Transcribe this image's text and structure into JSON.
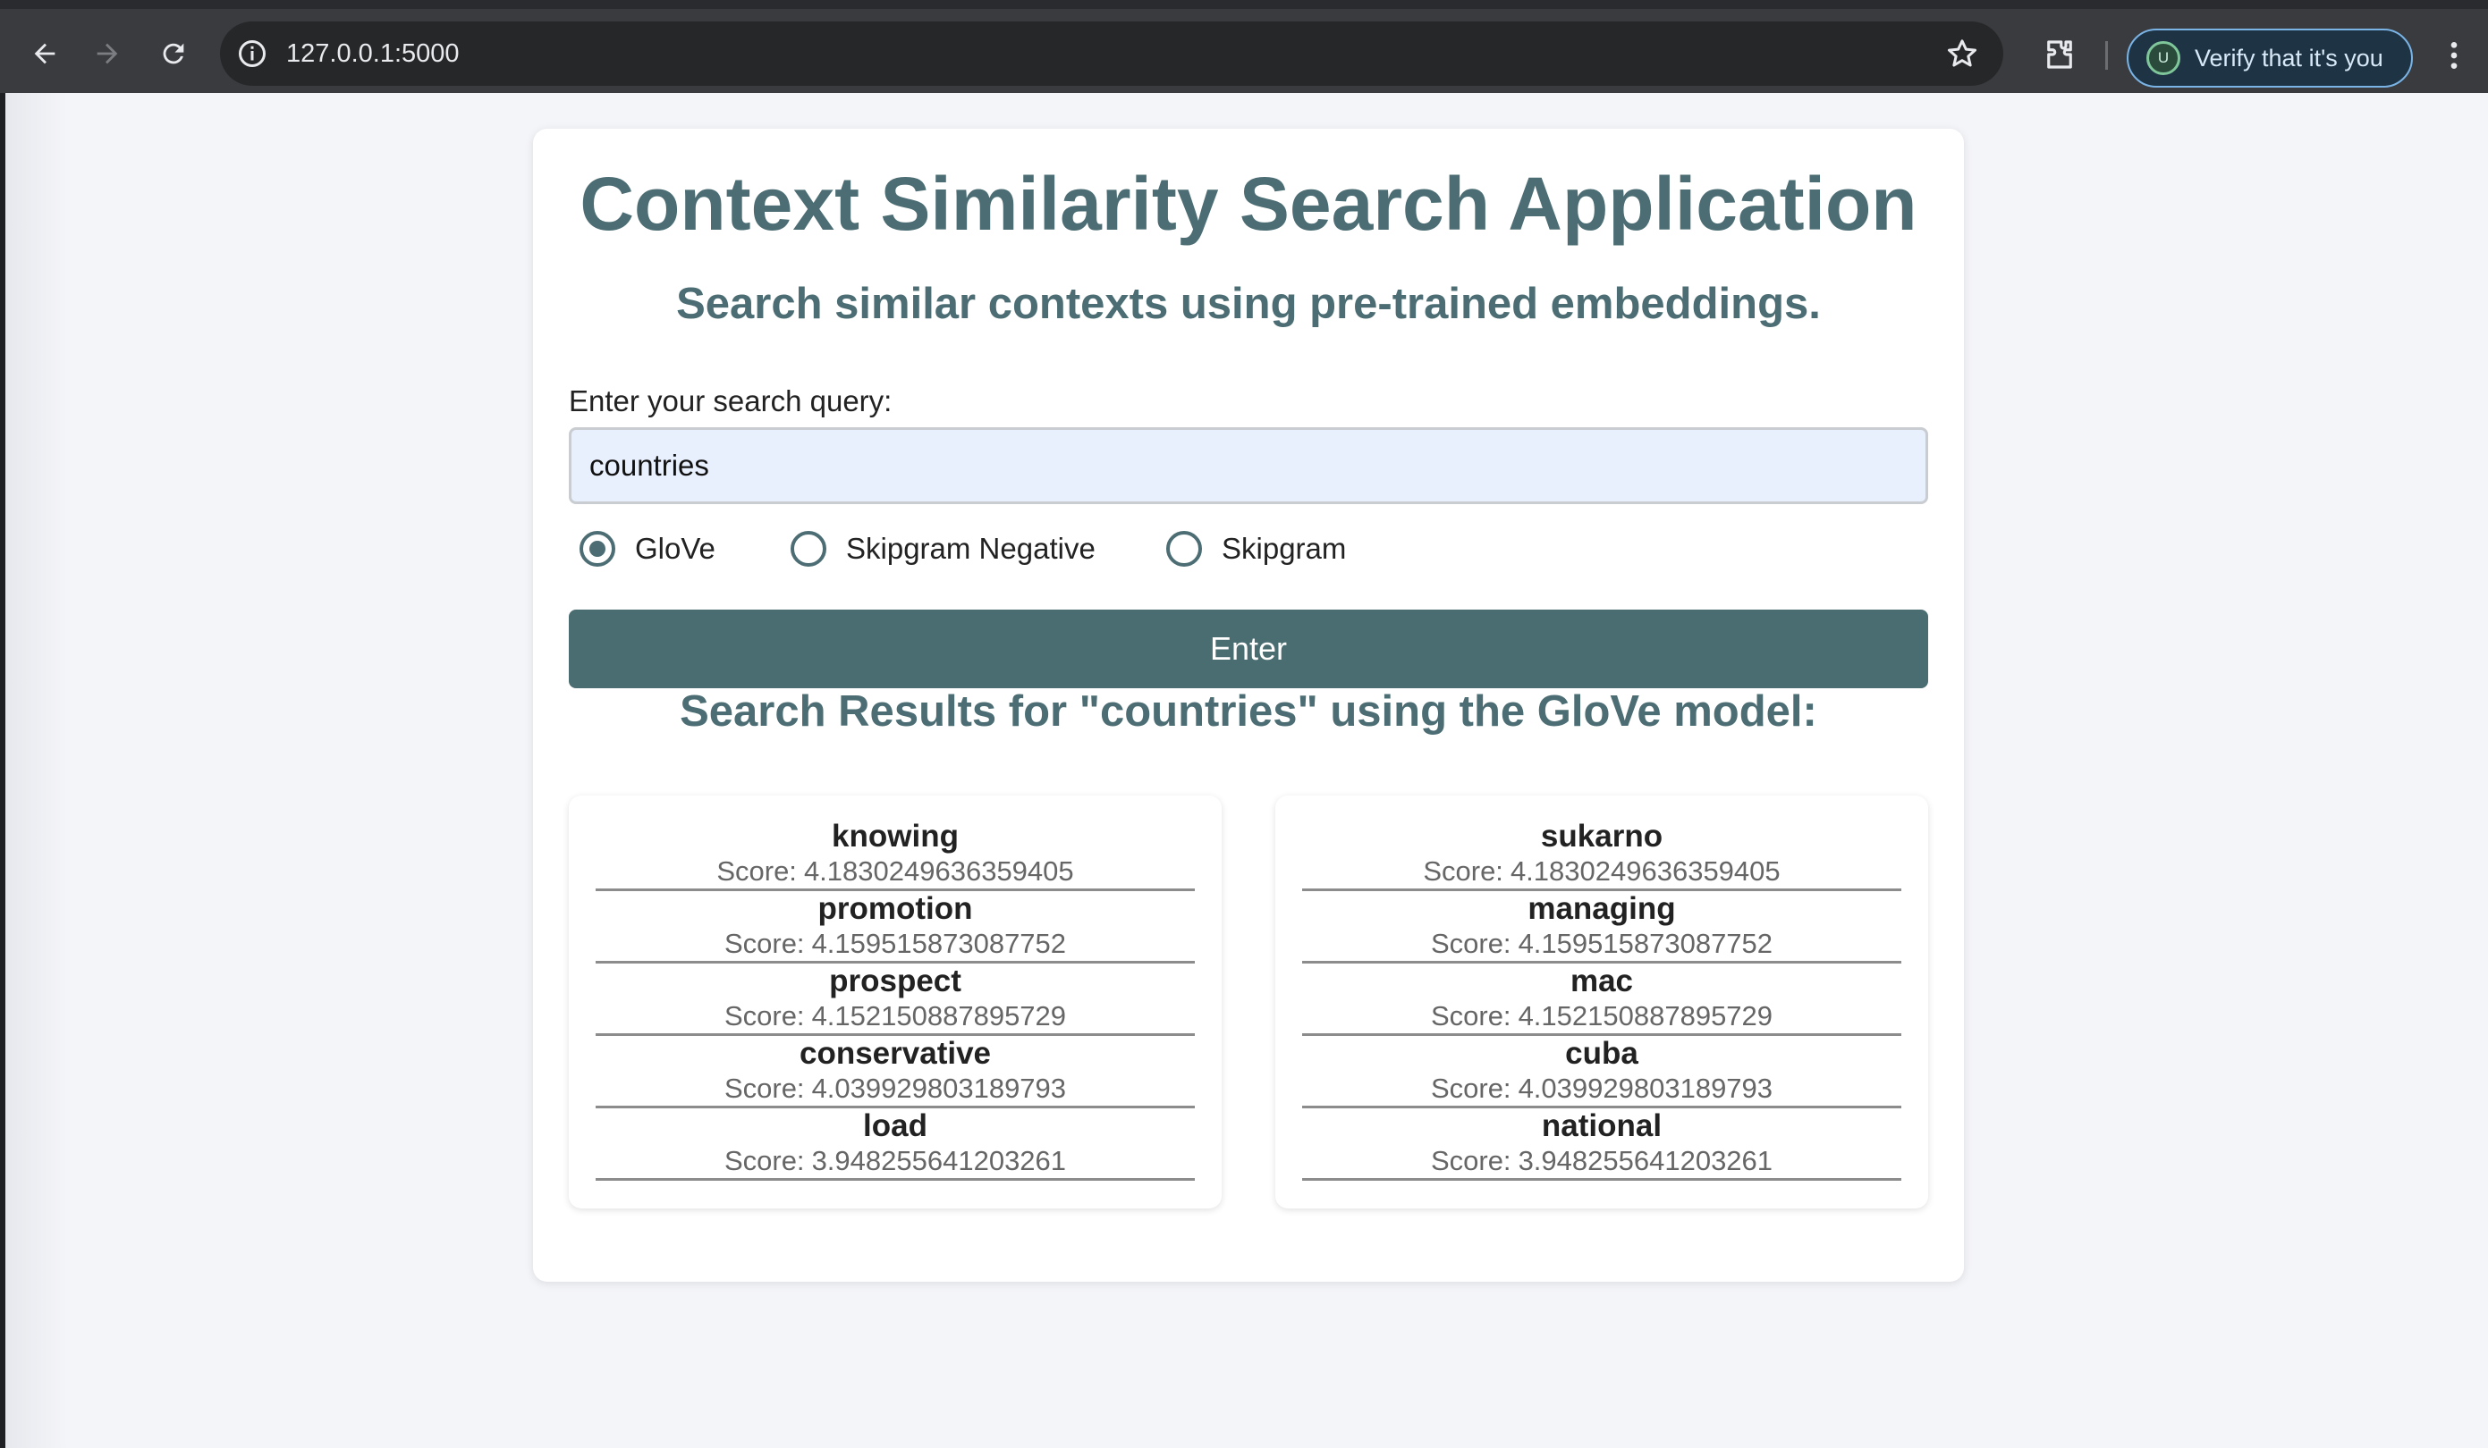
{
  "browser": {
    "url": "127.0.0.1:5000",
    "verify_label": "Verify that it's you",
    "profile_initial": "U"
  },
  "app": {
    "title": "Context Similarity Search Application",
    "subtitle": "Search similar contexts using pre-trained embeddings.",
    "query_label": "Enter your search query:",
    "query_value": "countries",
    "models": [
      {
        "label": "GloVe",
        "checked": true
      },
      {
        "label": "Skipgram Negative",
        "checked": false
      },
      {
        "label": "Skipgram",
        "checked": false
      }
    ],
    "enter_label": "Enter",
    "results_heading": "Search Results for \"countries\" using the GloVe model:",
    "score_prefix": "Score:",
    "results_left": [
      {
        "word": "knowing",
        "score": "4.1830249636359405"
      },
      {
        "word": "promotion",
        "score": "4.159515873087752"
      },
      {
        "word": "prospect",
        "score": "4.152150887895729"
      },
      {
        "word": "conservative",
        "score": "4.039929803189793"
      },
      {
        "word": "load",
        "score": "3.948255641203261"
      }
    ],
    "results_right": [
      {
        "word": "sukarno",
        "score": "4.1830249636359405"
      },
      {
        "word": "managing",
        "score": "4.159515873087752"
      },
      {
        "word": "mac",
        "score": "4.152150887895729"
      },
      {
        "word": "cuba",
        "score": "4.039929803189793"
      },
      {
        "word": "national",
        "score": "3.948255641203261"
      }
    ]
  },
  "colors": {
    "accent": "#4a6d72",
    "page_background": "#f4f5f9",
    "input_background": "#e8f0fe"
  }
}
